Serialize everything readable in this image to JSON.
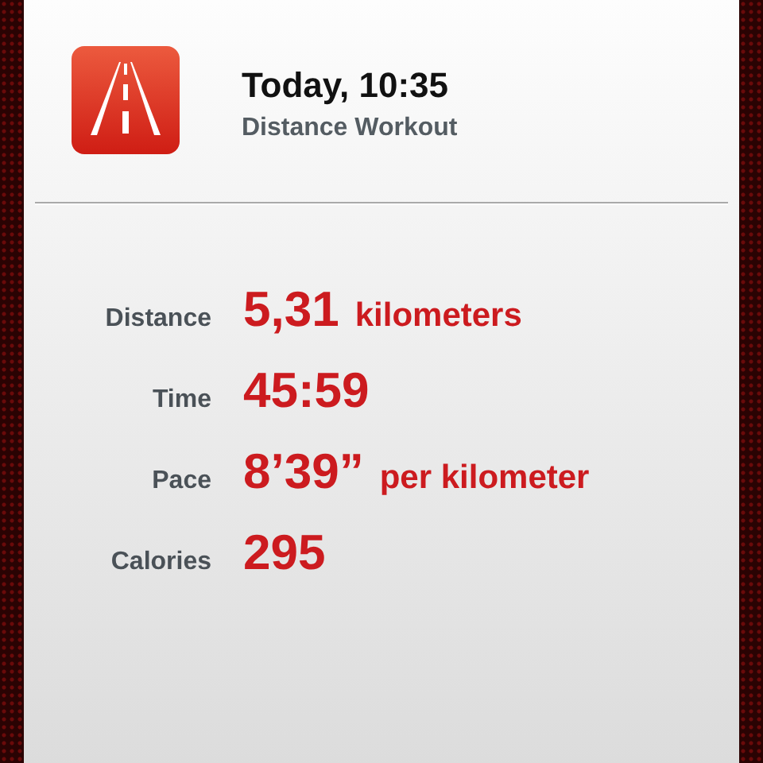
{
  "header": {
    "title": "Today, 10:35",
    "subtitle": "Distance Workout"
  },
  "stats": [
    {
      "label": "Distance",
      "value": "5,31",
      "unit": "kilometers"
    },
    {
      "label": "Time",
      "value": "45:59"
    },
    {
      "label": "Pace",
      "value": "8’39”",
      "unit": "per kilometer"
    },
    {
      "label": "Calories",
      "value": "295"
    }
  ]
}
